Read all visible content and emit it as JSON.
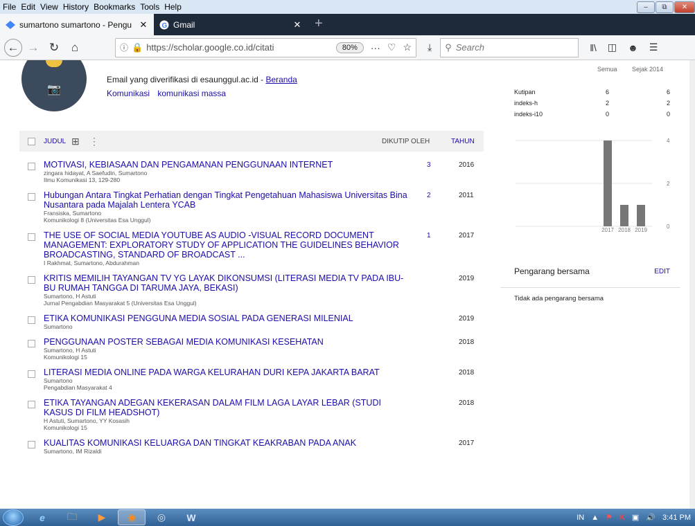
{
  "browser": {
    "menu": [
      "File",
      "Edit",
      "View",
      "History",
      "Bookmarks",
      "Tools",
      "Help"
    ],
    "tabs": [
      {
        "title": "sumartono sumartono - Pengu",
        "active": true
      },
      {
        "title": "Gmail",
        "active": false
      }
    ],
    "url": "https://scholar.google.co.id/citati",
    "zoom": "80%",
    "search_placeholder": "Search"
  },
  "profile": {
    "verified_text": "Email yang diverifikasi di esaunggul.ac.id - ",
    "verified_link": "Beranda",
    "interests": [
      "Komunikasi",
      "komunikasi massa"
    ]
  },
  "table_header": {
    "title": "JUDUL",
    "cited_by": "DIKUTIP OLEH",
    "year": "TAHUN"
  },
  "articles": [
    {
      "title": "MOTIVASI, KEBIASAAN DAN PENGAMANAN PENGGUNAAN INTERNET",
      "authors": "zingara hidayat, A Saefudin, Sumartono",
      "venue": "Ilmu Komunikasi 13, 129-280",
      "cites": "3",
      "year": "2016"
    },
    {
      "title": "Hubungan Antara Tingkat Perhatian dengan Tingkat Pengetahuan Mahasiswa Universitas Bina Nusantara pada Majalah Lentera YCAB",
      "authors": "Fransiska, Sumartono",
      "venue": "Komunikologi 8 (Universitas Esa Unggul)",
      "cites": "2",
      "year": "2011"
    },
    {
      "title": "THE USE OF SOCIAL MEDIA YOUTUBE AS AUDIO -VISUAL RECORD DOCUMENT MANAGEMENT: EXPLORATORY STUDY OF APPLICATION THE GUIDELINES BEHAVIOR BROADCASTING, STANDARD OF BROADCAST ...",
      "authors": "I Rakhmat, Sumartono, Abdurahman",
      "venue": "",
      "cites": "1",
      "year": "2017"
    },
    {
      "title": "KRITIS MEMILIH TAYANGAN TV YG LAYAK DIKONSUMSI (LITERASI MEDIA TV PADA IBU-BU RUMAH TANGGA DI TARUMA JAYA, BEKASI)",
      "authors": "Sumartono, H Astuti",
      "venue": "Jurnal Pengabdian Masyarakat 5 (Universitas Esa Unggul)",
      "cites": "",
      "year": "2019"
    },
    {
      "title": "ETIKA KOMUNIKASI PENGGUNA MEDIA SOSIAL PADA GENERASI MILENIAL",
      "authors": "Sumartono",
      "venue": "",
      "cites": "",
      "year": "2019"
    },
    {
      "title": "PENGGUNAAN POSTER SEBAGAI MEDIA KOMUNIKASI KESEHATAN",
      "authors": "Sumartono, H Astuti",
      "venue": "Komunikologi 15",
      "cites": "",
      "year": "2018"
    },
    {
      "title": "LITERASI MEDIA ONLINE PADA WARGA KELURAHAN DURI KEPA JAKARTA BARAT",
      "authors": "Sumartono",
      "venue": "Pengabdian Masyarakat 4",
      "cites": "",
      "year": "2018"
    },
    {
      "title": "ETIKA TAYANGAN ADEGAN KEKERASAN DALAM FILM LAGA LAYAR LEBAR (STUDI KASUS DI FILM HEADSHOT)",
      "authors": "H Astuti, Sumartono, YY Kosasih",
      "venue": "Komunikologi 15",
      "cites": "",
      "year": "2018"
    },
    {
      "title": "KUALITAS KOMUNIKASI KELUARGA DAN TINGKAT KEAKRABAN PADA ANAK",
      "authors": "Sumartono, IM Rizaldi",
      "venue": "",
      "cites": "",
      "year": "2017"
    }
  ],
  "stats": {
    "col_all": "Semua",
    "col_since": "Sejak 2014",
    "rows": [
      {
        "label": "Kutipan",
        "all": "6",
        "since": "6"
      },
      {
        "label": "indeks-h",
        "all": "2",
        "since": "2"
      },
      {
        "label": "indeks-i10",
        "all": "0",
        "since": "0"
      }
    ]
  },
  "chart_data": {
    "type": "bar",
    "categories": [
      "2017",
      "2018",
      "2019"
    ],
    "values": [
      4,
      1,
      1
    ],
    "ylim": [
      0,
      4
    ],
    "yticks": [
      "4",
      "2",
      "0"
    ],
    "grid": true,
    "bar_color": "#777777"
  },
  "coauthors": {
    "title": "Pengarang bersama",
    "edit": "EDIT",
    "empty": "Tidak ada pengarang bersama"
  },
  "taskbar": {
    "lang": "IN",
    "time": "3:41 PM"
  }
}
